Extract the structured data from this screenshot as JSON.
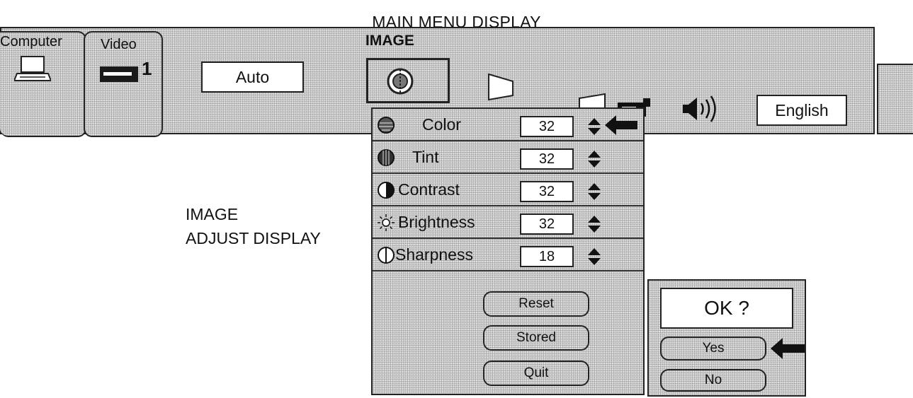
{
  "captions": {
    "main": "MAIN MENU DISPLAY",
    "adjust_line1": "IMAGE",
    "adjust_line2": "ADJUST DISPLAY"
  },
  "menu_bar": {
    "title": "IMAGE",
    "tabs": [
      {
        "label": "Computer",
        "icon": "laptop-icon"
      },
      {
        "label": "Video",
        "icon": "vcr-icon",
        "number": "1"
      }
    ],
    "auto_label": "Auto",
    "language": "English",
    "icons": [
      "image-adjust-icon",
      "keystone-icon",
      "keystone-icon",
      "projector-icon",
      "speaker-icon"
    ]
  },
  "adjust_panel": {
    "rows": [
      {
        "label": "Color",
        "value": "32",
        "icon": "color-icon",
        "selected": true
      },
      {
        "label": "Tint",
        "value": "32",
        "icon": "tint-icon"
      },
      {
        "label": "Contrast",
        "value": "32",
        "icon": "contrast-icon"
      },
      {
        "label": "Brightness",
        "value": "32",
        "icon": "brightness-icon"
      },
      {
        "label": "Sharpness",
        "value": "18",
        "icon": "sharpness-icon"
      }
    ],
    "buttons": {
      "reset": "Reset",
      "stored": "Stored",
      "quit": "Quit"
    }
  },
  "confirm_dialog": {
    "title": "OK ?",
    "yes": "Yes",
    "no": "No"
  }
}
